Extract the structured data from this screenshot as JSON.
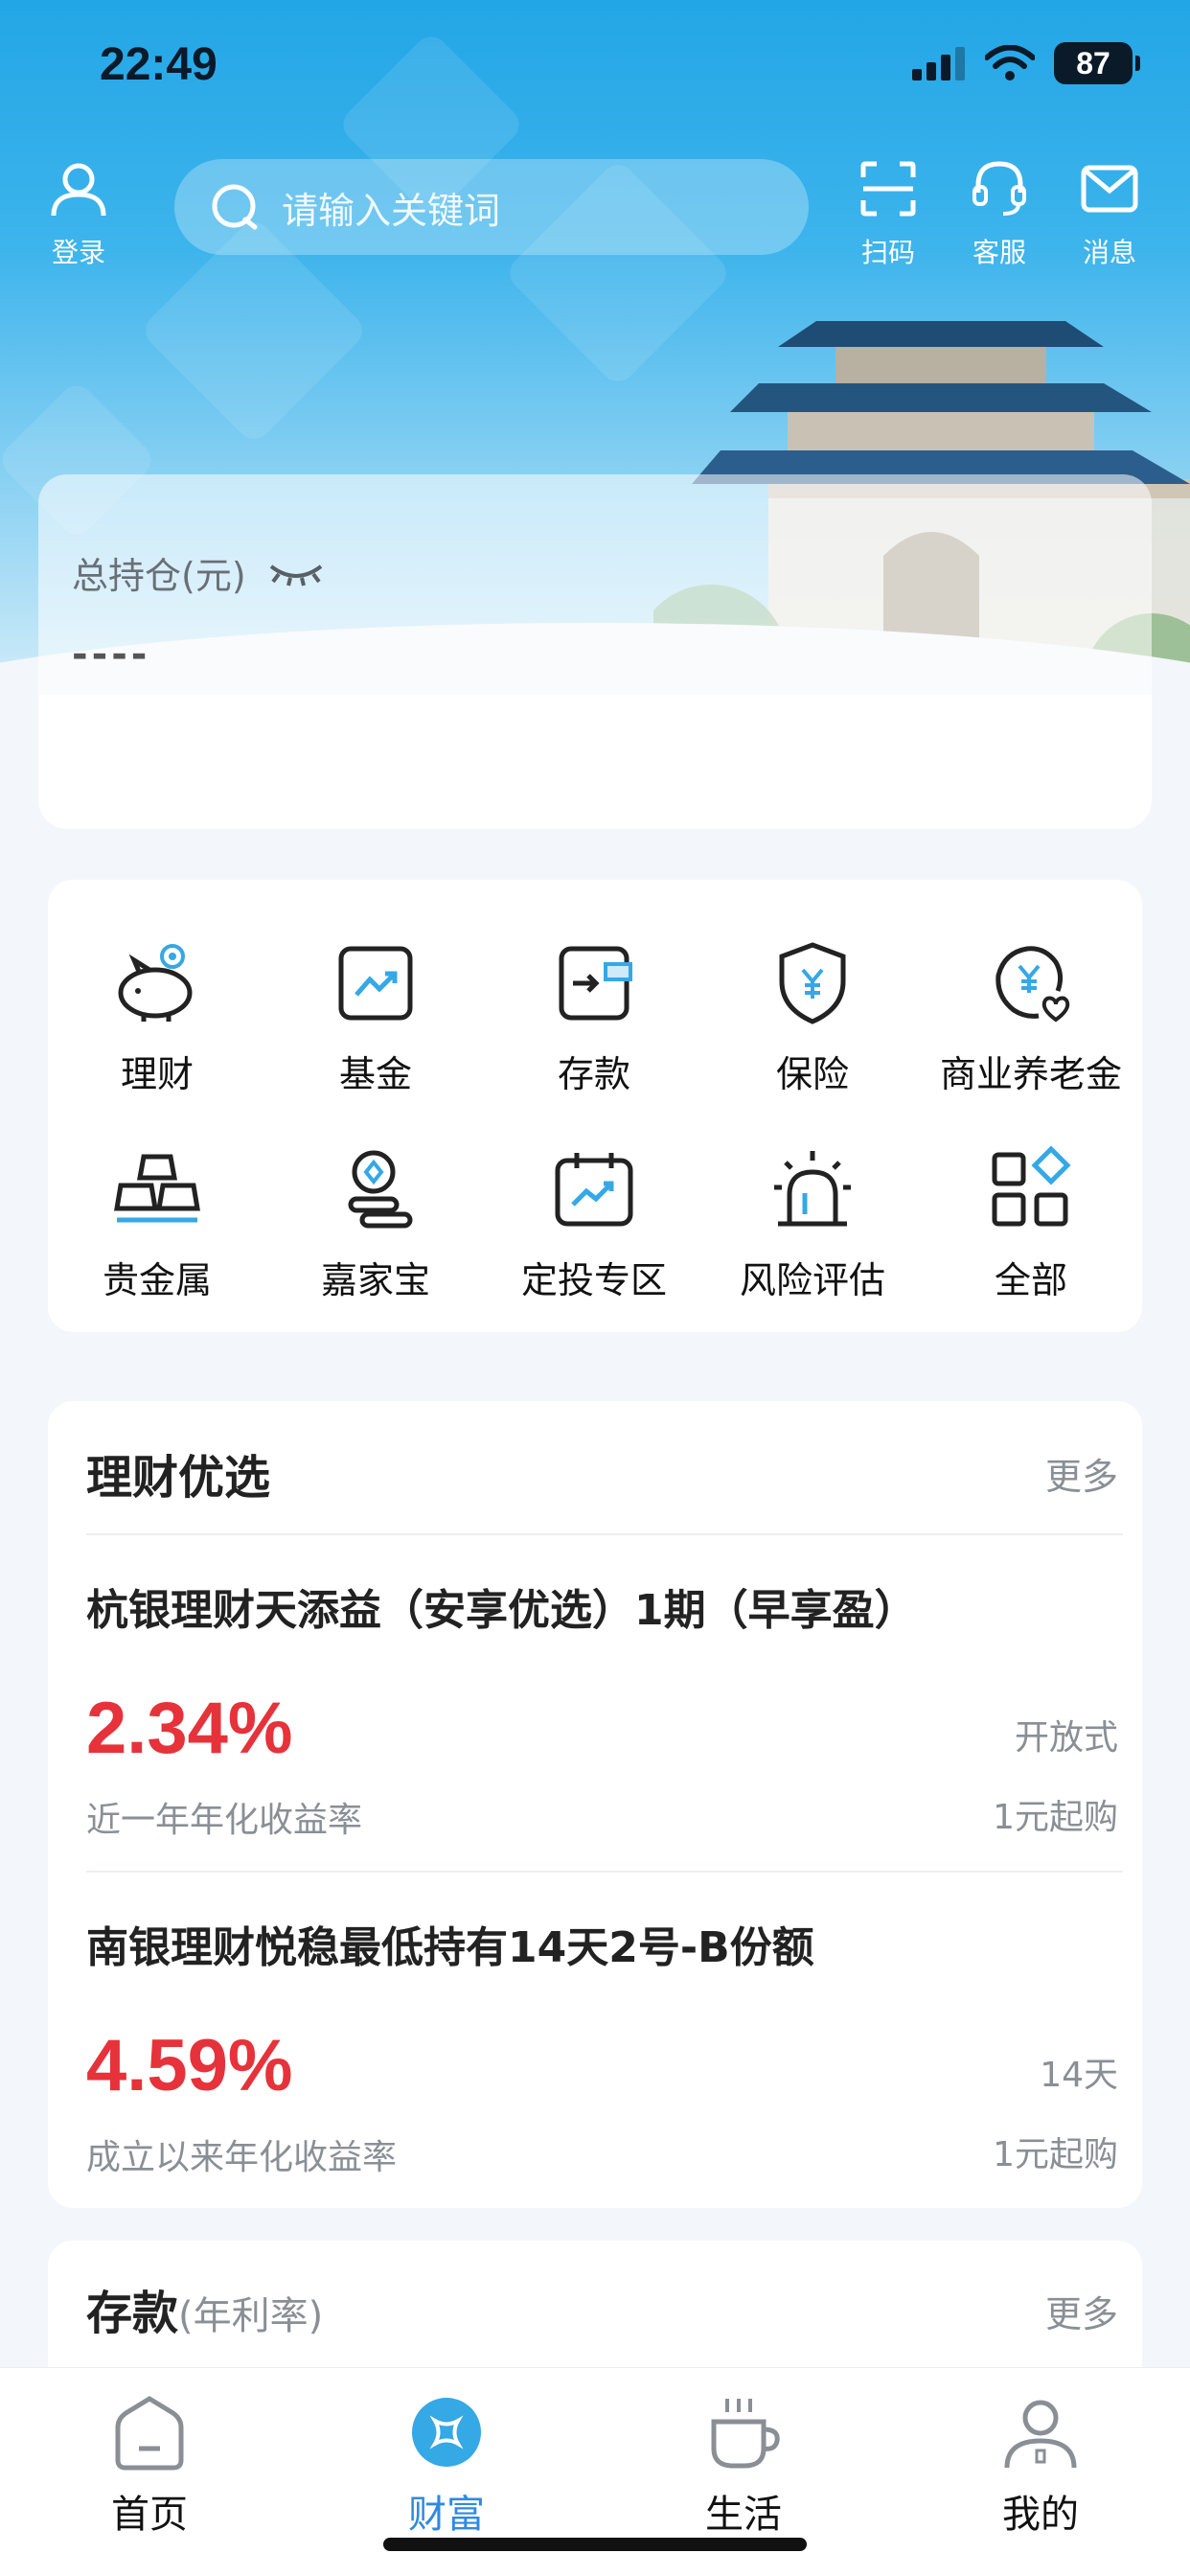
{
  "status_bar": {
    "time": "22:49",
    "battery": "87"
  },
  "header": {
    "login_label": "登录",
    "search_placeholder": "请输入关键词",
    "scan_label": "扫码",
    "service_label": "客服",
    "message_label": "消息"
  },
  "holdings": {
    "title": "总持仓(元)",
    "value": "----"
  },
  "menu": {
    "items": [
      {
        "label": "理财",
        "icon": "piggy-bank-icon"
      },
      {
        "label": "基金",
        "icon": "fund-chart-icon"
      },
      {
        "label": "存款",
        "icon": "deposit-icon"
      },
      {
        "label": "保险",
        "icon": "insurance-shield-icon"
      },
      {
        "label": "商业养老金",
        "icon": "pension-icon"
      },
      {
        "label": "贵金属",
        "icon": "gold-bars-icon"
      },
      {
        "label": "嘉家宝",
        "icon": "coins-icon"
      },
      {
        "label": "定投专区",
        "icon": "calendar-chart-icon"
      },
      {
        "label": "风险评估",
        "icon": "alarm-light-icon"
      },
      {
        "label": "全部",
        "icon": "grid-all-icon"
      }
    ]
  },
  "wealth_picks": {
    "title": "理财优选",
    "more": "更多",
    "products": [
      {
        "name": "杭银理财天添益（安享优选）1期（早享盈）",
        "rate": "2.34%",
        "rate_label": "近一年年化收益率",
        "tag1": "开放式",
        "tag2": "1元起购"
      },
      {
        "name": "南银理财悦稳最低持有14天2号-B份额",
        "rate": "4.59%",
        "rate_label": "成立以来年化收益率",
        "tag1": "14天",
        "tag2": "1元起购"
      }
    ]
  },
  "deposit": {
    "title": "存款",
    "subtitle": "(年利率)",
    "more": "更多"
  },
  "tabbar": {
    "tabs": [
      {
        "label": "首页",
        "icon": "home-icon"
      },
      {
        "label": "财富",
        "icon": "wealth-icon"
      },
      {
        "label": "生活",
        "icon": "coffee-cup-icon"
      },
      {
        "label": "我的",
        "icon": "profile-icon"
      }
    ],
    "active": "财富"
  },
  "colors": {
    "accent": "#2f8ae0",
    "rate_red": "#e6323a",
    "hero_blue": "#23a6e6"
  }
}
